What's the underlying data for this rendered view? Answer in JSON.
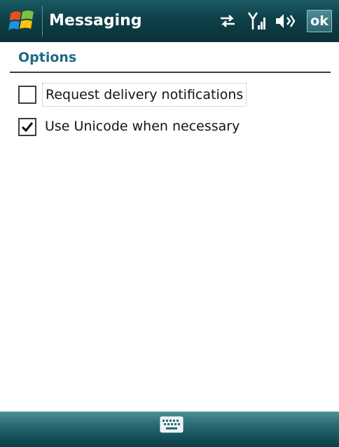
{
  "titlebar": {
    "app_title": "Messaging",
    "ok_label": "ok",
    "icons": [
      "windows-start-icon",
      "connection-arrows-icon",
      "signal-strength-icon",
      "volume-icon"
    ]
  },
  "page": {
    "header": "Options"
  },
  "options": [
    {
      "label": "Request delivery notifications",
      "checked": false
    },
    {
      "label": "Use Unicode when necessary",
      "checked": true
    }
  ],
  "menubar": {
    "icons": [
      "keyboard-icon"
    ]
  },
  "colors": {
    "titlebar": "#0e4048",
    "header_text": "#1c6a86",
    "focus_outline": "#8dbfd0"
  }
}
